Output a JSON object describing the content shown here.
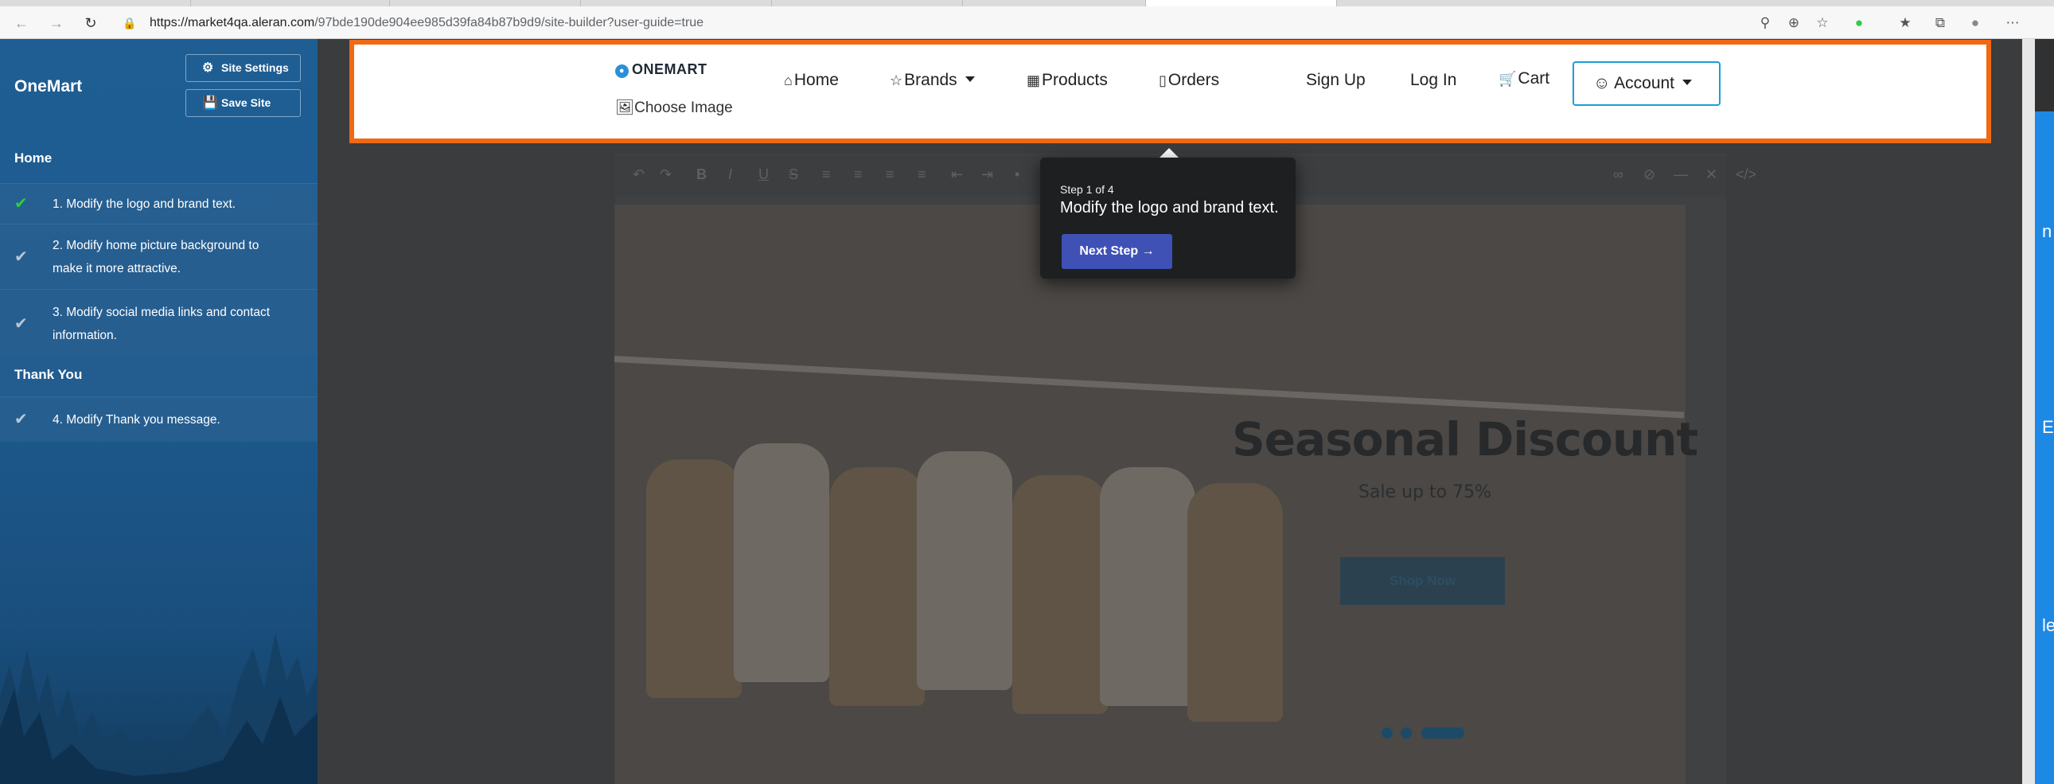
{
  "browser": {
    "url_host": "https://market4qa.aleran.com",
    "url_path": "/97bde190de904ee985d39fa84b87b9d9/site-builder?user-guide=true",
    "icons": [
      "back-icon",
      "forward-icon",
      "reload-icon",
      "lock-icon",
      "key-icon",
      "zoom-icon",
      "star-icon",
      "extension-icon",
      "favorites-icon",
      "collections-icon",
      "profile-icon",
      "more-icon"
    ]
  },
  "sidebar": {
    "brand": "OneMart",
    "site_settings_label": "Site Settings",
    "save_site_label": "Save Site",
    "sections": [
      {
        "title": "Home",
        "steps": [
          {
            "text": "1. Modify the logo and brand text.",
            "done": true
          },
          {
            "text": "2. Modify home picture background to make it more attractive.",
            "done": false
          },
          {
            "text": "3. Modify social media links and contact information.",
            "done": false
          }
        ]
      },
      {
        "title": "Thank You",
        "steps": [
          {
            "text": "4. Modify Thank you message.",
            "done": false
          }
        ]
      }
    ]
  },
  "header": {
    "logo_text": "ONEMART",
    "choose_image_label": "Choose Image",
    "nav": {
      "home": "Home",
      "brands": "Brands",
      "products": "Products",
      "orders": "Orders",
      "sign_up": "Sign Up",
      "log_in": "Log In",
      "cart": "Cart",
      "account": "Account"
    },
    "highlight_color": "#f06a13"
  },
  "tooltip": {
    "step_count": "Step 1 of 4",
    "message": "Modify the logo and brand text.",
    "next_label": "Next Step →",
    "button_color": "#3f51b5"
  },
  "hero": {
    "title": "Seasonal Discount",
    "subtitle": "Sale up to 75%",
    "button_label": "Shop Now"
  },
  "right_edge_glyphs": [
    "n",
    "E",
    "le"
  ]
}
